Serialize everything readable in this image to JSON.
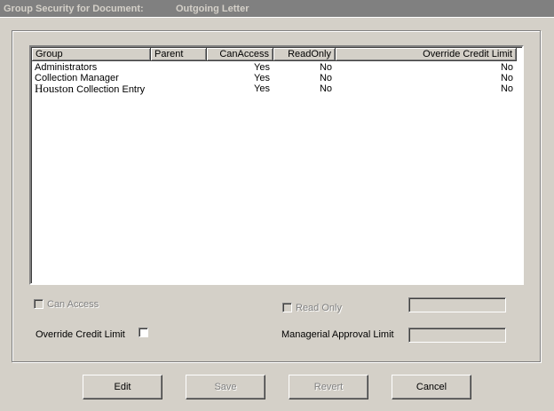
{
  "title_bar": {
    "label": "Group Security for Document:",
    "document_name": "Outgoing Letter"
  },
  "list": {
    "columns": [
      "Group",
      "Parent",
      "CanAccess",
      "ReadOnly",
      "Override Credit Limit"
    ],
    "rows": [
      {
        "group_prefix": "",
        "group": "Administrators",
        "parent": "",
        "can_access": "Yes",
        "read_only": "No",
        "override_credit_limit": "No"
      },
      {
        "group_prefix": "",
        "group": "Collection Manager",
        "parent": "",
        "can_access": "Yes",
        "read_only": "No",
        "override_credit_limit": "No"
      },
      {
        "group_prefix": "Houston",
        "group": " Collection Entry",
        "parent": "",
        "can_access": "Yes",
        "read_only": "No",
        "override_credit_limit": "No"
      }
    ]
  },
  "form": {
    "can_access_label": "Can Access",
    "read_only_label": "Read Only",
    "override_credit_limit_label": "Override Credit Limit",
    "managerial_approval_limit_label": "Managerial Approval Limit",
    "read_only_value": "",
    "managerial_approval_limit_value": ""
  },
  "buttons": {
    "edit": "Edit",
    "save": "Save",
    "revert": "Revert",
    "cancel": "Cancel"
  }
}
